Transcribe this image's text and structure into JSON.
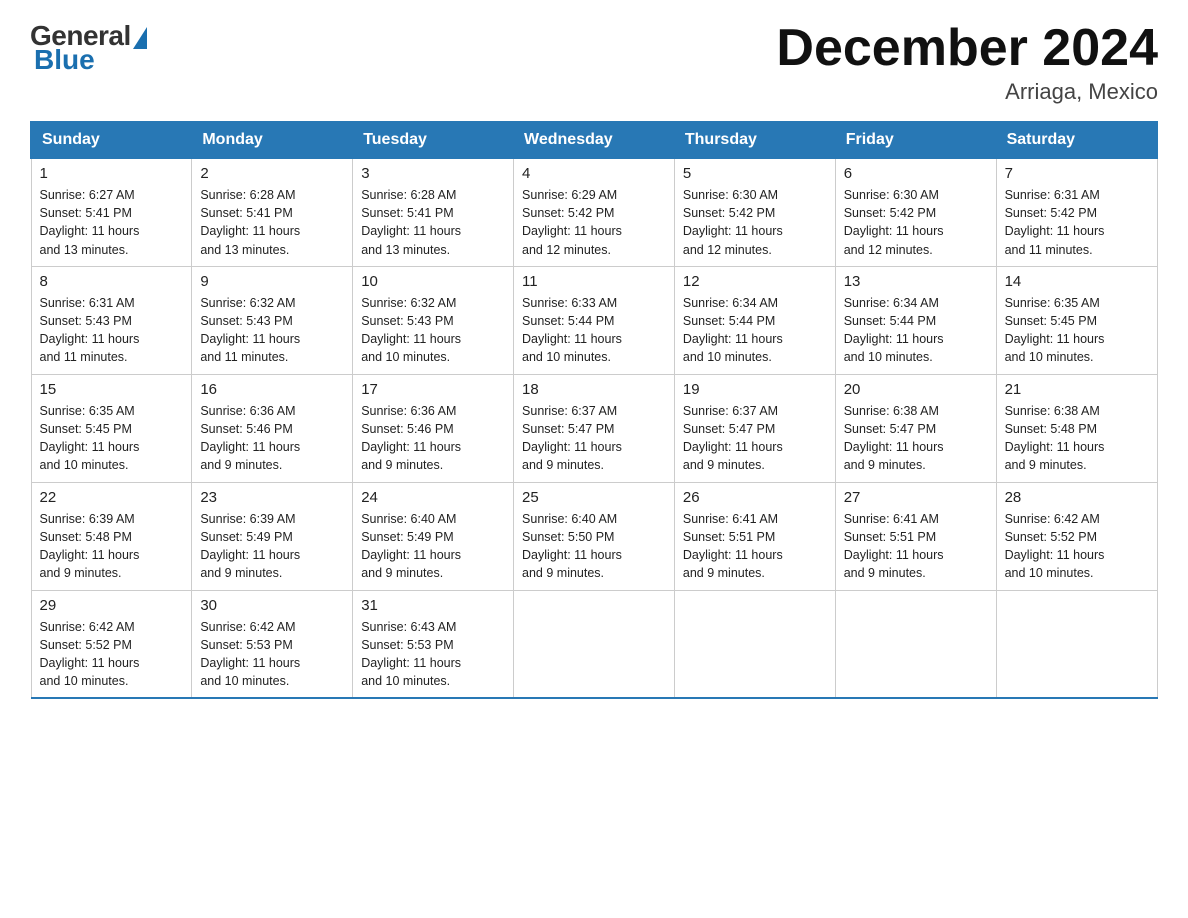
{
  "logo": {
    "general": "General",
    "blue": "Blue"
  },
  "header": {
    "month": "December 2024",
    "location": "Arriaga, Mexico"
  },
  "days_of_week": [
    "Sunday",
    "Monday",
    "Tuesday",
    "Wednesday",
    "Thursday",
    "Friday",
    "Saturday"
  ],
  "weeks": [
    [
      {
        "day": "1",
        "sunrise": "6:27 AM",
        "sunset": "5:41 PM",
        "daylight": "11 hours and 13 minutes."
      },
      {
        "day": "2",
        "sunrise": "6:28 AM",
        "sunset": "5:41 PM",
        "daylight": "11 hours and 13 minutes."
      },
      {
        "day": "3",
        "sunrise": "6:28 AM",
        "sunset": "5:41 PM",
        "daylight": "11 hours and 13 minutes."
      },
      {
        "day": "4",
        "sunrise": "6:29 AM",
        "sunset": "5:42 PM",
        "daylight": "11 hours and 12 minutes."
      },
      {
        "day": "5",
        "sunrise": "6:30 AM",
        "sunset": "5:42 PM",
        "daylight": "11 hours and 12 minutes."
      },
      {
        "day": "6",
        "sunrise": "6:30 AM",
        "sunset": "5:42 PM",
        "daylight": "11 hours and 12 minutes."
      },
      {
        "day": "7",
        "sunrise": "6:31 AM",
        "sunset": "5:42 PM",
        "daylight": "11 hours and 11 minutes."
      }
    ],
    [
      {
        "day": "8",
        "sunrise": "6:31 AM",
        "sunset": "5:43 PM",
        "daylight": "11 hours and 11 minutes."
      },
      {
        "day": "9",
        "sunrise": "6:32 AM",
        "sunset": "5:43 PM",
        "daylight": "11 hours and 11 minutes."
      },
      {
        "day": "10",
        "sunrise": "6:32 AM",
        "sunset": "5:43 PM",
        "daylight": "11 hours and 10 minutes."
      },
      {
        "day": "11",
        "sunrise": "6:33 AM",
        "sunset": "5:44 PM",
        "daylight": "11 hours and 10 minutes."
      },
      {
        "day": "12",
        "sunrise": "6:34 AM",
        "sunset": "5:44 PM",
        "daylight": "11 hours and 10 minutes."
      },
      {
        "day": "13",
        "sunrise": "6:34 AM",
        "sunset": "5:44 PM",
        "daylight": "11 hours and 10 minutes."
      },
      {
        "day": "14",
        "sunrise": "6:35 AM",
        "sunset": "5:45 PM",
        "daylight": "11 hours and 10 minutes."
      }
    ],
    [
      {
        "day": "15",
        "sunrise": "6:35 AM",
        "sunset": "5:45 PM",
        "daylight": "11 hours and 10 minutes."
      },
      {
        "day": "16",
        "sunrise": "6:36 AM",
        "sunset": "5:46 PM",
        "daylight": "11 hours and 9 minutes."
      },
      {
        "day": "17",
        "sunrise": "6:36 AM",
        "sunset": "5:46 PM",
        "daylight": "11 hours and 9 minutes."
      },
      {
        "day": "18",
        "sunrise": "6:37 AM",
        "sunset": "5:47 PM",
        "daylight": "11 hours and 9 minutes."
      },
      {
        "day": "19",
        "sunrise": "6:37 AM",
        "sunset": "5:47 PM",
        "daylight": "11 hours and 9 minutes."
      },
      {
        "day": "20",
        "sunrise": "6:38 AM",
        "sunset": "5:47 PM",
        "daylight": "11 hours and 9 minutes."
      },
      {
        "day": "21",
        "sunrise": "6:38 AM",
        "sunset": "5:48 PM",
        "daylight": "11 hours and 9 minutes."
      }
    ],
    [
      {
        "day": "22",
        "sunrise": "6:39 AM",
        "sunset": "5:48 PM",
        "daylight": "11 hours and 9 minutes."
      },
      {
        "day": "23",
        "sunrise": "6:39 AM",
        "sunset": "5:49 PM",
        "daylight": "11 hours and 9 minutes."
      },
      {
        "day": "24",
        "sunrise": "6:40 AM",
        "sunset": "5:49 PM",
        "daylight": "11 hours and 9 minutes."
      },
      {
        "day": "25",
        "sunrise": "6:40 AM",
        "sunset": "5:50 PM",
        "daylight": "11 hours and 9 minutes."
      },
      {
        "day": "26",
        "sunrise": "6:41 AM",
        "sunset": "5:51 PM",
        "daylight": "11 hours and 9 minutes."
      },
      {
        "day": "27",
        "sunrise": "6:41 AM",
        "sunset": "5:51 PM",
        "daylight": "11 hours and 9 minutes."
      },
      {
        "day": "28",
        "sunrise": "6:42 AM",
        "sunset": "5:52 PM",
        "daylight": "11 hours and 10 minutes."
      }
    ],
    [
      {
        "day": "29",
        "sunrise": "6:42 AM",
        "sunset": "5:52 PM",
        "daylight": "11 hours and 10 minutes."
      },
      {
        "day": "30",
        "sunrise": "6:42 AM",
        "sunset": "5:53 PM",
        "daylight": "11 hours and 10 minutes."
      },
      {
        "day": "31",
        "sunrise": "6:43 AM",
        "sunset": "5:53 PM",
        "daylight": "11 hours and 10 minutes."
      },
      null,
      null,
      null,
      null
    ]
  ],
  "labels": {
    "sunrise": "Sunrise:",
    "sunset": "Sunset:",
    "daylight": "Daylight:"
  }
}
